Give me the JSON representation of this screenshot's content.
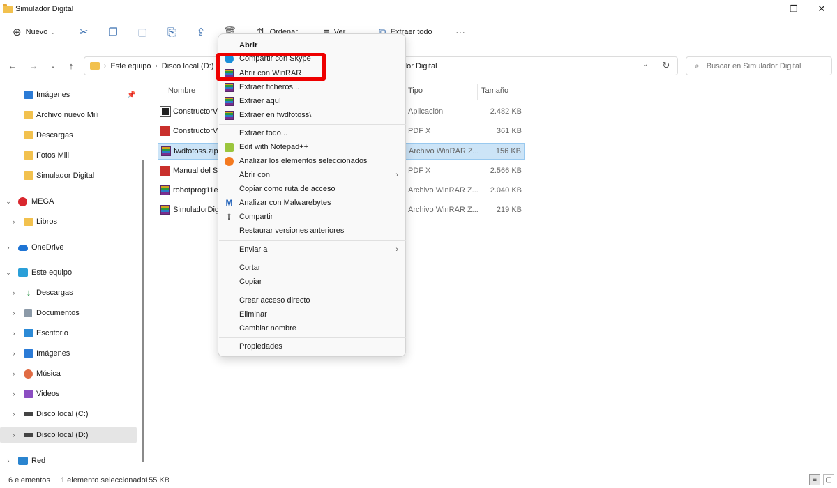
{
  "window": {
    "title": "Simulador Digital",
    "minimize": "—",
    "maximize": "❐",
    "close": "✕"
  },
  "commandbar": {
    "new_label": "Nuevo",
    "sort_label": "Ordenar",
    "view_label": "Ver",
    "extract_all_label": "Extraer todo",
    "more_label": "···"
  },
  "address": {
    "crumbs": [
      "Este equipo",
      "Disco local (D:)"
    ],
    "visible_tail": "dor Digital",
    "search_placeholder": "Buscar en Simulador Digital"
  },
  "nav": {
    "items": [
      {
        "label": "Imágenes",
        "icon": "image-icon"
      },
      {
        "label": "Archivo nuevo Mili",
        "icon": "folder-icon"
      },
      {
        "label": "Descargas",
        "icon": "folder-icon"
      },
      {
        "label": "Fotos Mili",
        "icon": "folder-icon"
      },
      {
        "label": "Simulador Digital",
        "icon": "folder-icon"
      },
      {
        "label": "MEGA",
        "icon": "mega-icon"
      },
      {
        "label": "Libros",
        "icon": "folder-icon"
      },
      {
        "label": "OneDrive",
        "icon": "cloud-icon"
      },
      {
        "label": "Este equipo",
        "icon": "computer-icon"
      },
      {
        "label": "Descargas",
        "icon": "download-icon"
      },
      {
        "label": "Documentos",
        "icon": "document-icon"
      },
      {
        "label": "Escritorio",
        "icon": "desktop-icon"
      },
      {
        "label": "Imágenes",
        "icon": "image-icon"
      },
      {
        "label": "Música",
        "icon": "music-icon"
      },
      {
        "label": "Videos",
        "icon": "video-icon"
      },
      {
        "label": "Disco local (C:)",
        "icon": "drive-icon"
      },
      {
        "label": "Disco local (D:)",
        "icon": "drive-icon"
      },
      {
        "label": "Red",
        "icon": "network-icon"
      }
    ]
  },
  "files": {
    "columns": {
      "name": "Nombre",
      "type": "Tipo",
      "size": "Tamaño"
    },
    "rows": [
      {
        "name": "ConstructorVi",
        "type": "Aplicación",
        "size": "2.482 KB",
        "icon": "app-icon"
      },
      {
        "name": "ConstructorVi",
        "type": "PDF X",
        "size": "361 KB",
        "icon": "pdf-icon"
      },
      {
        "name": "fwdfotoss.zip",
        "type": "Archivo WinRAR Z...",
        "size": "156 KB",
        "icon": "winrar-icon"
      },
      {
        "name": "Manual del Si",
        "type": "PDF X",
        "size": "2.566 KB",
        "icon": "pdf-icon"
      },
      {
        "name": "robotprog11e",
        "type": "Archivo WinRAR Z...",
        "size": "2.040 KB",
        "icon": "winrar-icon"
      },
      {
        "name": "SimuladorDig",
        "type": "Archivo WinRAR Z...",
        "size": "219 KB",
        "icon": "winrar-icon"
      }
    ]
  },
  "context_menu": {
    "items": [
      {
        "label": "Abrir"
      },
      {
        "label": "Compartir con Skype"
      },
      {
        "label": "Abrir con WinRAR"
      },
      {
        "label": "Extraer ficheros..."
      },
      {
        "label": "Extraer aquí"
      },
      {
        "label": "Extraer en fwdfotoss\\"
      },
      {
        "label": "Extraer todo..."
      },
      {
        "label": "Edit with Notepad++"
      },
      {
        "label": "Analizar los elementos seleccionados"
      },
      {
        "label": "Abrir con"
      },
      {
        "label": "Copiar como ruta de acceso"
      },
      {
        "label": "Analizar con Malwarebytes"
      },
      {
        "label": "Compartir"
      },
      {
        "label": "Restaurar versiones anteriores"
      },
      {
        "label": "Enviar a"
      },
      {
        "label": "Cortar"
      },
      {
        "label": "Copiar"
      },
      {
        "label": "Crear acceso directo"
      },
      {
        "label": "Eliminar"
      },
      {
        "label": "Cambiar nombre"
      },
      {
        "label": "Propiedades"
      }
    ]
  },
  "status": {
    "count": "6 elementos",
    "selected": "1 elemento seleccionado",
    "size": "155 KB"
  },
  "colors": {
    "selection": "#cce4f7",
    "highlight_box": "#ee0000",
    "accent": "#3a6fb0"
  }
}
